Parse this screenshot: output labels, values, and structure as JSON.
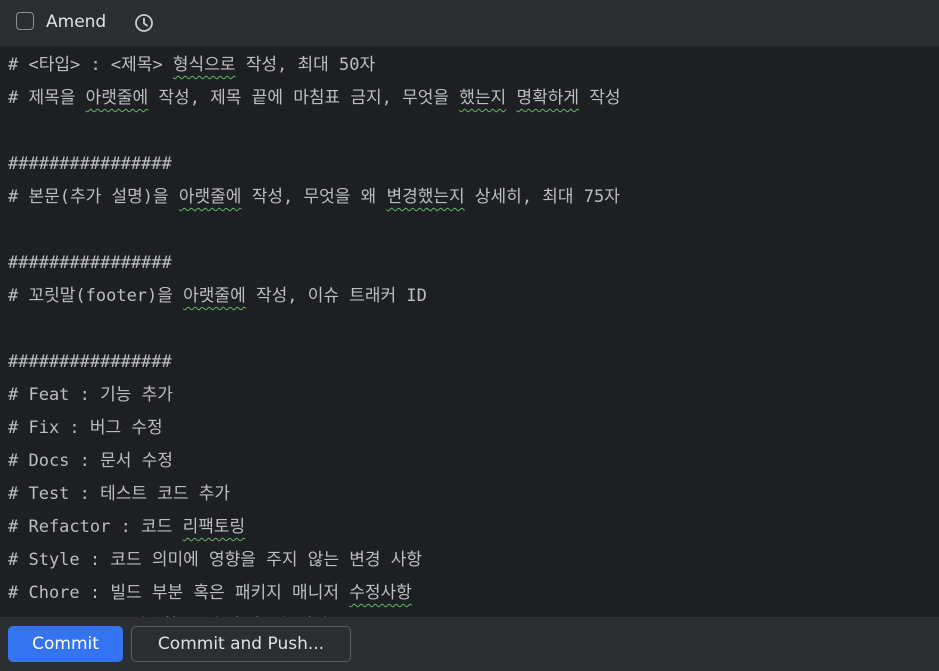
{
  "toolbar": {
    "amend_label": "Amend",
    "amend_checked": false,
    "history_icon": "clock-history-icon"
  },
  "editor": {
    "lines": [
      {
        "segments": [
          {
            "text": "# <타입> : <제목> ",
            "typo": false
          },
          {
            "text": "형식으로",
            "typo": true
          },
          {
            "text": " 작성, 최대 50자",
            "typo": false
          }
        ]
      },
      {
        "segments": [
          {
            "text": "# 제목을 ",
            "typo": false
          },
          {
            "text": "아랫줄에",
            "typo": true
          },
          {
            "text": " 작성, 제목 끝에 마침표 금지, 무엇을 ",
            "typo": false
          },
          {
            "text": "했는지",
            "typo": true
          },
          {
            "text": " ",
            "typo": false
          },
          {
            "text": "명확하게",
            "typo": true
          },
          {
            "text": " 작성",
            "typo": false
          }
        ]
      },
      {
        "segments": [
          {
            "text": "",
            "typo": false
          }
        ]
      },
      {
        "segments": [
          {
            "text": "################",
            "typo": false
          }
        ]
      },
      {
        "segments": [
          {
            "text": "# 본문(추가 설명)을 ",
            "typo": false
          },
          {
            "text": "아랫줄에",
            "typo": true
          },
          {
            "text": " 작성, 무엇을 왜 ",
            "typo": false
          },
          {
            "text": "변경했는지",
            "typo": true
          },
          {
            "text": " 상세히, 최대 75자",
            "typo": false
          }
        ]
      },
      {
        "segments": [
          {
            "text": "",
            "typo": false
          }
        ]
      },
      {
        "segments": [
          {
            "text": "################",
            "typo": false
          }
        ]
      },
      {
        "segments": [
          {
            "text": "# 꼬릿말(footer)을 ",
            "typo": false
          },
          {
            "text": "아랫줄에",
            "typo": true
          },
          {
            "text": " 작성, 이슈 트래커 ID",
            "typo": false
          }
        ]
      },
      {
        "segments": [
          {
            "text": "",
            "typo": false
          }
        ]
      },
      {
        "segments": [
          {
            "text": "################",
            "typo": false
          }
        ]
      },
      {
        "segments": [
          {
            "text": "# Feat : 기능 추가",
            "typo": false
          }
        ]
      },
      {
        "segments": [
          {
            "text": "# Fix : 버그 수정",
            "typo": false
          }
        ]
      },
      {
        "segments": [
          {
            "text": "# Docs : 문서 수정",
            "typo": false
          }
        ]
      },
      {
        "segments": [
          {
            "text": "# Test : 테스트 코드 추가",
            "typo": false
          }
        ]
      },
      {
        "segments": [
          {
            "text": "# Refactor : 코드 ",
            "typo": false
          },
          {
            "text": "리팩토링",
            "typo": true
          }
        ]
      },
      {
        "segments": [
          {
            "text": "# Style : 코드 의미에 영향을 주지 않는 변경 사항",
            "typo": false
          }
        ]
      },
      {
        "segments": [
          {
            "text": "# Chore : 빌드 부분 혹은 패키지 매니저 ",
            "typo": false
          },
          {
            "text": "수정사항",
            "typo": true
          }
        ]
      },
      {
        "segments": [
          {
            "text": "# Comment : 필요한 주석 추가 및 변경",
            "typo": false
          }
        ]
      }
    ]
  },
  "actions": {
    "commit_label": "Commit",
    "commit_push_label": "Commit and Push..."
  },
  "colors": {
    "primary_button": "#3574f0",
    "editor_background": "#1e1f22",
    "panel_background": "#2b2d30",
    "spellcheck_underline": "#5fb865"
  }
}
